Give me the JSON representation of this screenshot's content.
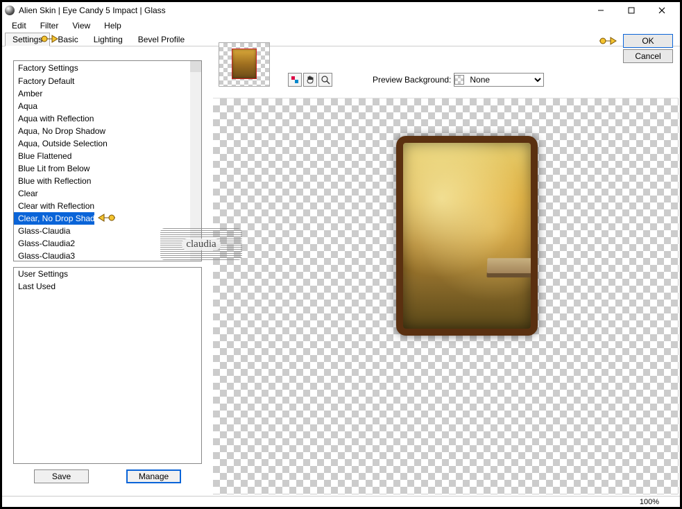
{
  "window": {
    "title": "Alien Skin | Eye Candy 5 Impact | Glass"
  },
  "menubar": [
    "Edit",
    "Filter",
    "View",
    "Help"
  ],
  "tabs": [
    "Settings",
    "Basic",
    "Lighting",
    "Bevel Profile"
  ],
  "active_tab": "Settings",
  "factory": {
    "header": "Factory Settings",
    "items": [
      "Factory Default",
      "Amber",
      "Aqua",
      "Aqua with Reflection",
      "Aqua, No Drop Shadow",
      "Aqua, Outside Selection",
      "Blue Flattened",
      "Blue Lit from Below",
      "Blue with Reflection",
      "Clear",
      "Clear with Reflection",
      "Clear, No Drop Shadow",
      "Glass-Claudia",
      "Glass-Claudia2",
      "Glass-Claudia3"
    ],
    "selected_index": 11
  },
  "user": {
    "items": [
      "User Settings",
      "Last Used"
    ]
  },
  "buttons": {
    "save": "Save",
    "manage": "Manage"
  },
  "preview_bg": {
    "label": "Preview Background:",
    "value": "None"
  },
  "actions": {
    "ok": "OK",
    "cancel": "Cancel"
  },
  "status": {
    "zoom": "100%"
  },
  "watermark": "claudia"
}
